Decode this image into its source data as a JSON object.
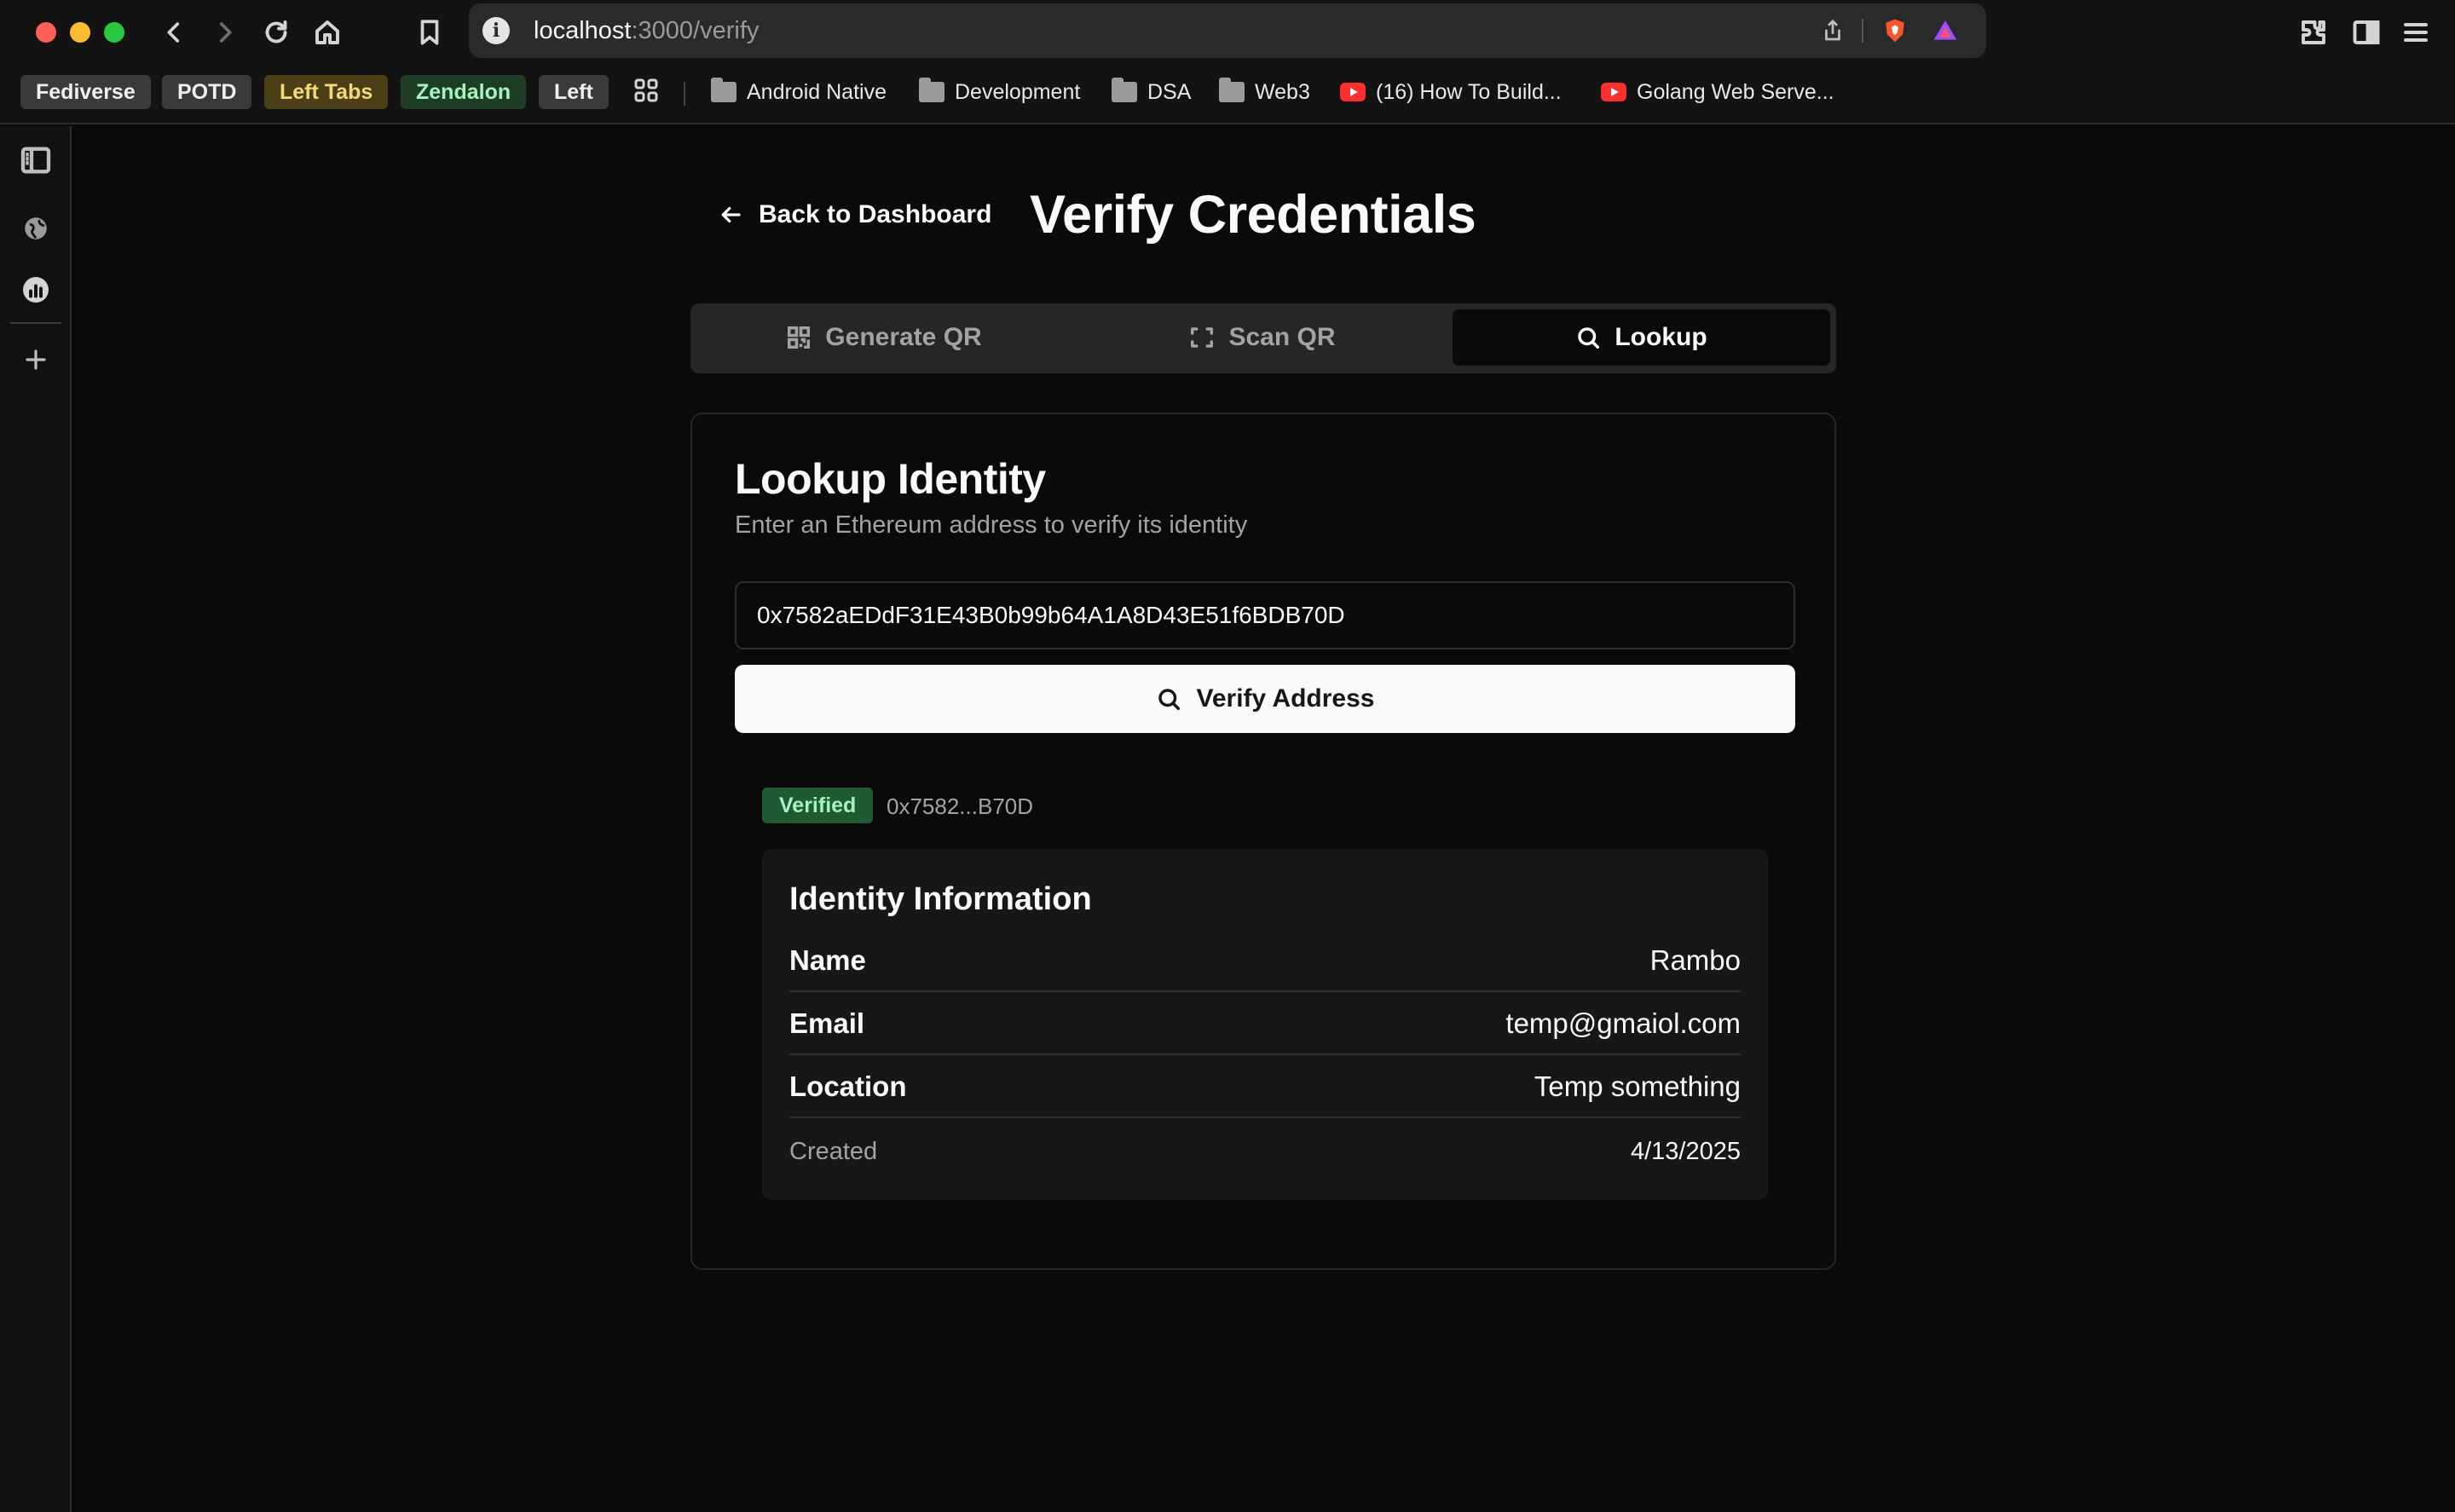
{
  "browser": {
    "url_host": "localhost",
    "url_path": ":3000/verify",
    "bookmarks": [
      {
        "label": "Fediverse",
        "bg": "#3a3a3a",
        "color": "#f0f0f0"
      },
      {
        "label": "POTD",
        "bg": "#3a3a3a",
        "color": "#f0f0f0"
      },
      {
        "label": "Left Tabs",
        "bg": "#4a3f16",
        "color": "#f5d97a"
      },
      {
        "label": "Zendalon",
        "bg": "#1d3d24",
        "color": "#a7f3c0"
      },
      {
        "label": "Left",
        "bg": "#3a3a3a",
        "color": "#f0f0f0"
      }
    ],
    "bookmark_folders": [
      "Android Native",
      "Development",
      "DSA",
      "Web3"
    ],
    "bookmark_videos": [
      "(16) How To Build...",
      "Golang Web Serve..."
    ]
  },
  "header": {
    "back_label": "Back to Dashboard",
    "title": "Verify Credentials"
  },
  "tabs": [
    {
      "label": "Generate QR",
      "icon": "qr-icon",
      "active": false
    },
    {
      "label": "Scan QR",
      "icon": "scan-icon",
      "active": false
    },
    {
      "label": "Lookup",
      "icon": "search-icon",
      "active": true
    }
  ],
  "lookup": {
    "title": "Lookup Identity",
    "description": "Enter an Ethereum address to verify its identity",
    "address_value": "0x7582aEDdF31E43B0b99b64A1A8D43E51f6BDB70D",
    "button_label": "Verify Address"
  },
  "result": {
    "status": "Verified",
    "short_address": "0x7582...B70D",
    "panel_title": "Identity Information",
    "fields": [
      {
        "key": "Name",
        "value": "Rambo"
      },
      {
        "key": "Email",
        "value": "temp@gmaiol.com"
      },
      {
        "key": "Location",
        "value": "Temp something"
      },
      {
        "key": "Created",
        "value": "4/13/2025"
      }
    ]
  },
  "colors": {
    "background": "#0a0a0a",
    "verified_badge": "#1e5b32",
    "primary_button": "#fafafa"
  }
}
